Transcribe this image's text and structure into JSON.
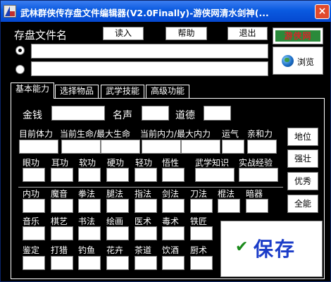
{
  "window": {
    "title": "武林群侠传存盘文件编辑器(V2.0Finally)-游侠网清水剑神(...",
    "close_glyph": "×"
  },
  "header": {
    "file_label": "存盘文件名",
    "load_button": "读入",
    "help_button": "帮助",
    "exit_button": "退出",
    "logo_text": "游侠网",
    "browse_button": "浏览",
    "path1_value": "",
    "path2_value": "",
    "radio1_selected": true,
    "radio2_selected": false
  },
  "tabs": [
    {
      "label": "基本能力",
      "active": true
    },
    {
      "label": "选择物品",
      "active": false
    },
    {
      "label": "武学技能",
      "active": false
    },
    {
      "label": "高级功能",
      "active": false
    }
  ],
  "basic": {
    "money_label": "金钱",
    "fame_label": "名声",
    "morality_label": "道德",
    "money_value": "",
    "fame_value": "",
    "morality_value": "",
    "stats_labels": [
      "目前体力",
      "当前生命/最大生命",
      "当前内力/最大内力",
      "运气",
      "亲和力"
    ],
    "attr_labels": [
      "眼功",
      "耳功",
      "软功",
      "硬功",
      "轻功",
      "悟性",
      "武学知识",
      "实战经验"
    ],
    "martial_labels": [
      "内功",
      "魔音",
      "拳法",
      "腿法",
      "指法",
      "剑法",
      "刀法",
      "棍法",
      "暗器"
    ],
    "arts_labels": [
      "音乐",
      "棋艺",
      "书法",
      "绘画",
      "医术",
      "毒术",
      "铁匠"
    ],
    "life_labels": [
      "鉴定",
      "打猎",
      "钓鱼",
      "花卉",
      "茶道",
      "饮酒",
      "厨术"
    ]
  },
  "side_buttons": [
    "地位",
    "强壮",
    "优秀",
    "全能"
  ],
  "save": {
    "check_glyph": "✔",
    "label": "保存"
  },
  "colors": {
    "title_bar": "#0a5ae0",
    "close_button": "#e14a2c",
    "save_text": "#1b3cc8",
    "check": "#1a8a1a"
  }
}
